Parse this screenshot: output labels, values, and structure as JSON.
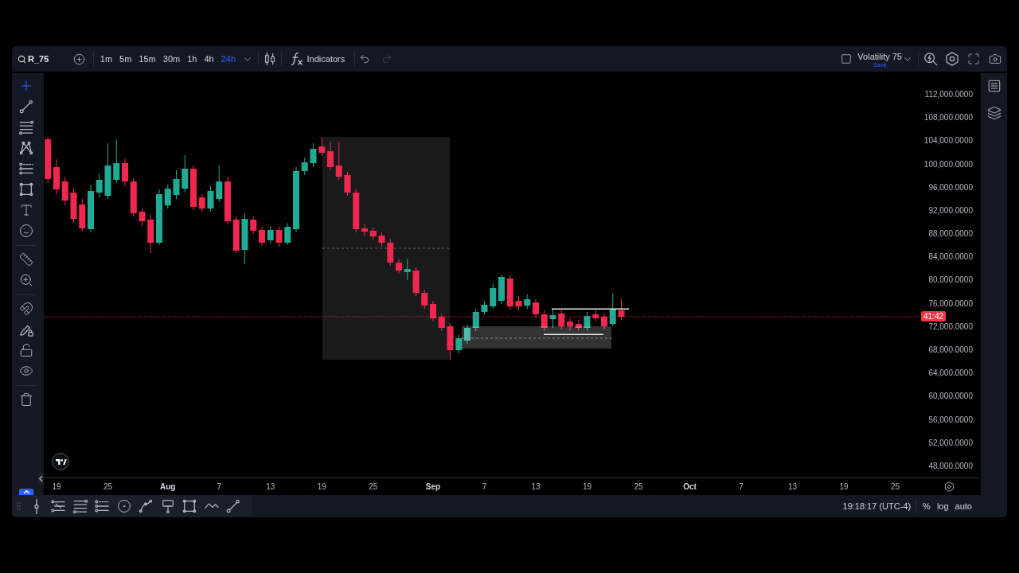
{
  "top_toolbar": {
    "symbol": "R_75",
    "timeframes": [
      {
        "label": "1m",
        "selected": false
      },
      {
        "label": "5m",
        "selected": false
      },
      {
        "label": "15m",
        "selected": false
      },
      {
        "label": "30m",
        "selected": false
      },
      {
        "label": "1h",
        "selected": false
      },
      {
        "label": "4h",
        "selected": false
      },
      {
        "label": "24h",
        "selected": true
      }
    ],
    "indicators": "Indicators",
    "undo": {
      "disabled": false
    },
    "redo": {
      "disabled": true
    },
    "layout": {
      "name": "Volatility 75",
      "save": "Save"
    }
  },
  "drawing_toolbar": {
    "groups": [
      {
        "tools": [
          {
            "selected": true
          },
          {
            "selected": false
          },
          {
            "selected": false
          },
          {
            "selected": false
          },
          {
            "selected": false
          },
          {
            "selected": false
          },
          {
            "selected": false
          },
          {
            "selected": false
          }
        ]
      },
      {
        "tools": [
          {
            "selected": false
          },
          {
            "selected": false
          }
        ]
      },
      {
        "tools": [
          {
            "selected": false
          },
          {
            "selected": false
          },
          {
            "selected": false
          },
          {
            "selected": false
          }
        ]
      },
      {
        "tools": [
          {
            "selected": false
          }
        ]
      }
    ]
  },
  "chart": {
    "price_axis": {
      "labels": [
        "112,000.0000",
        "108,000.0000",
        "104,000.0000",
        "100,000.0000",
        "96,000.0000",
        "92,000.0000",
        "88,000.0000",
        "84,000.0000",
        "80,000.0000",
        "76,000.0000",
        "72,000.0000",
        "68,000.0000",
        "64,000.0000",
        "60,000.0000",
        "56,000.0000",
        "52,000.0000",
        "48,000.0000"
      ],
      "countdown": "41:42"
    },
    "time_axis": {
      "labels": [
        {
          "text": "19",
          "kind": "day"
        },
        {
          "text": "25",
          "kind": "day"
        },
        {
          "text": "Aug",
          "kind": "month"
        },
        {
          "text": "7",
          "kind": "day"
        },
        {
          "text": "13",
          "kind": "day"
        },
        {
          "text": "19",
          "kind": "day"
        },
        {
          "text": "25",
          "kind": "day"
        },
        {
          "text": "Sep",
          "kind": "month"
        },
        {
          "text": "7",
          "kind": "day"
        },
        {
          "text": "13",
          "kind": "day"
        },
        {
          "text": "19",
          "kind": "day"
        },
        {
          "text": "25",
          "kind": "day"
        },
        {
          "text": "Oct",
          "kind": "month"
        },
        {
          "text": "7",
          "kind": "day"
        },
        {
          "text": "13",
          "kind": "day"
        },
        {
          "text": "19",
          "kind": "day"
        },
        {
          "text": "25",
          "kind": "day"
        }
      ]
    }
  },
  "status_bar": {
    "time": "19:18:17 (UTC-4)",
    "options": [
      "%",
      "log",
      "auto"
    ]
  }
}
